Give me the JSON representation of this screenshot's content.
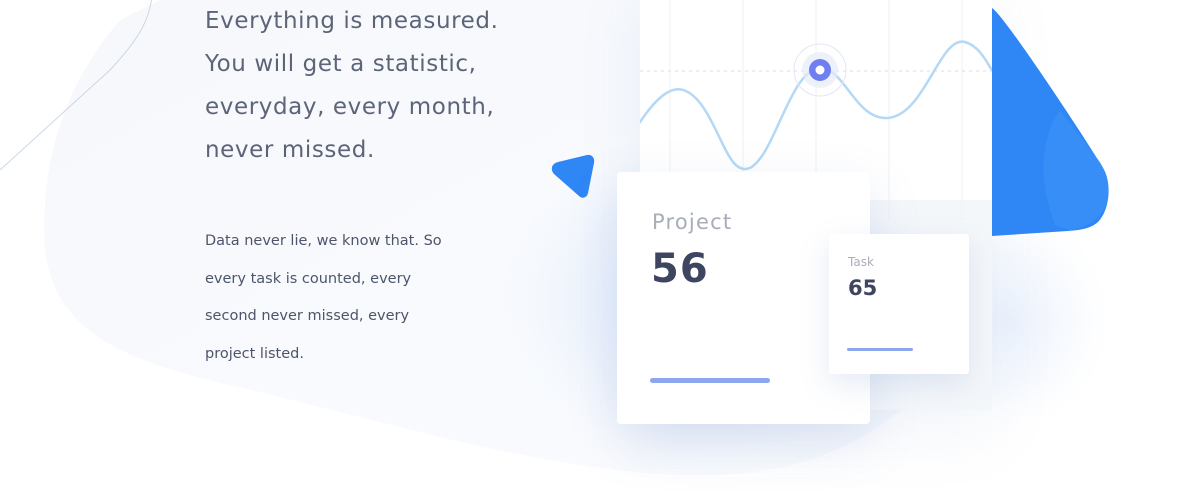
{
  "headline": {
    "lines": [
      "Everything is measured.",
      "You will get a statistic,",
      "everyday, every month,",
      "never missed."
    ]
  },
  "body": {
    "lines": [
      "Data never lie, we know that. So",
      "every task is counted, every",
      "second never missed, every",
      "project listed."
    ]
  },
  "project_card": {
    "label": "Project",
    "value": "56",
    "progress": 1.0
  },
  "task_card": {
    "label": "Task",
    "value": "65",
    "progress": 1.0
  },
  "colors": {
    "accent_blue": "#2f87f5",
    "line_blue": "#b4d8f5",
    "marker": "#6f7ff0",
    "bar": "#8ea6ee",
    "heading_text": "#5c6478",
    "value_text": "#3d4560"
  }
}
